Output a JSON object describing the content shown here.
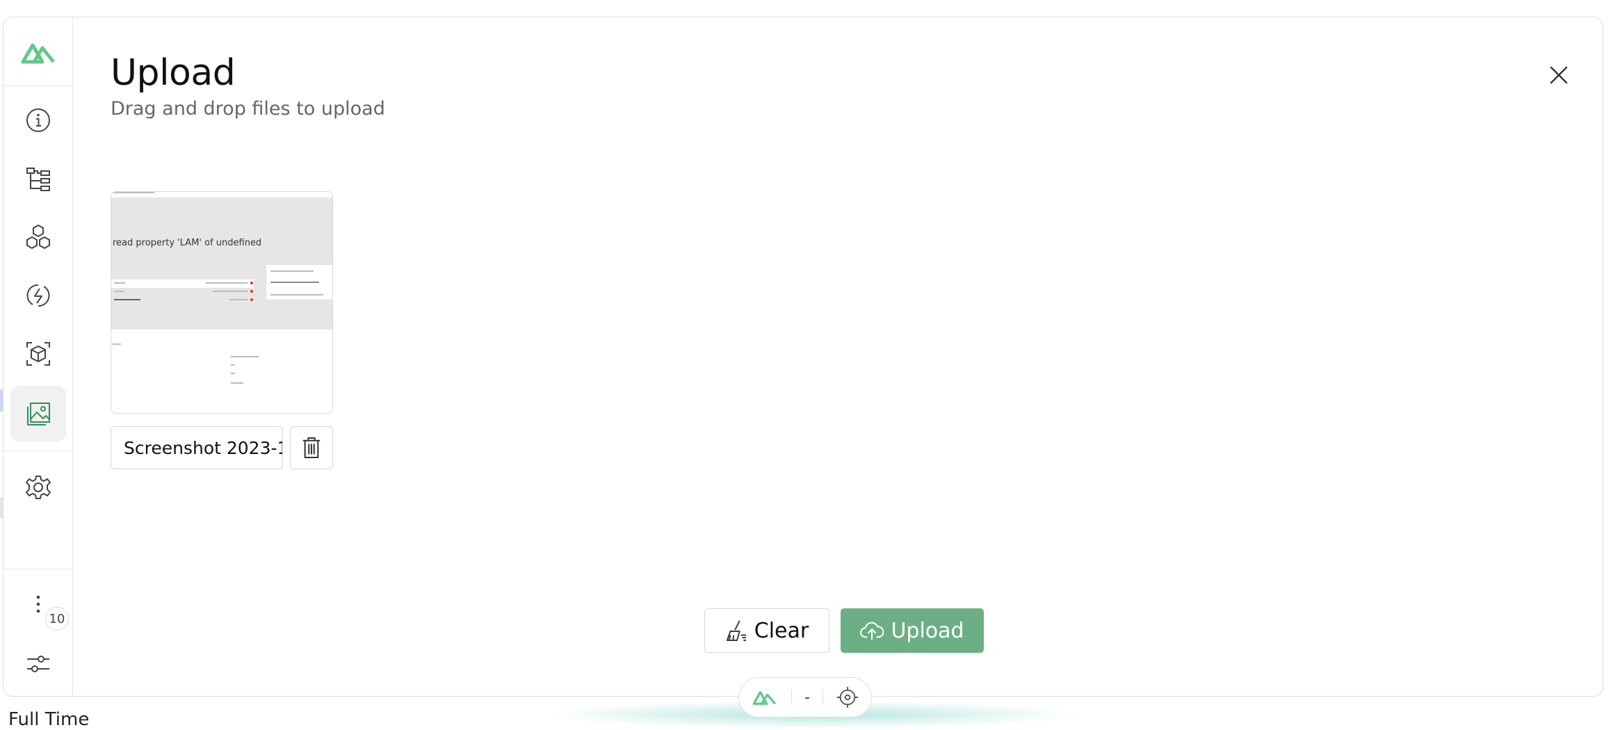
{
  "background": {
    "bottom_text": "Full Time"
  },
  "dialog": {
    "title": "Upload",
    "subtitle": "Drag and drop files to upload"
  },
  "sidebar": {
    "items": [
      {
        "icon": "logo-icon"
      },
      {
        "icon": "info-icon"
      },
      {
        "icon": "tree-icon"
      },
      {
        "icon": "components-icon"
      },
      {
        "icon": "bolt-icon"
      },
      {
        "icon": "cube-icon"
      },
      {
        "icon": "image-icon",
        "active": true
      },
      {
        "icon": "settings-icon"
      },
      {
        "icon": "more-icon"
      },
      {
        "icon": "sliders-icon"
      }
    ],
    "badge": "10"
  },
  "file": {
    "name": "Screenshot 2023-1",
    "thumbnail_error_text": "read property 'LAM' of undefined"
  },
  "actions": {
    "clear_label": "Clear",
    "upload_label": "Upload"
  },
  "footer": {
    "middle": "-"
  },
  "colors": {
    "accent": "#6caf84",
    "logo": "#5fc98a",
    "text": "#111111",
    "subtle_text": "#666666"
  }
}
